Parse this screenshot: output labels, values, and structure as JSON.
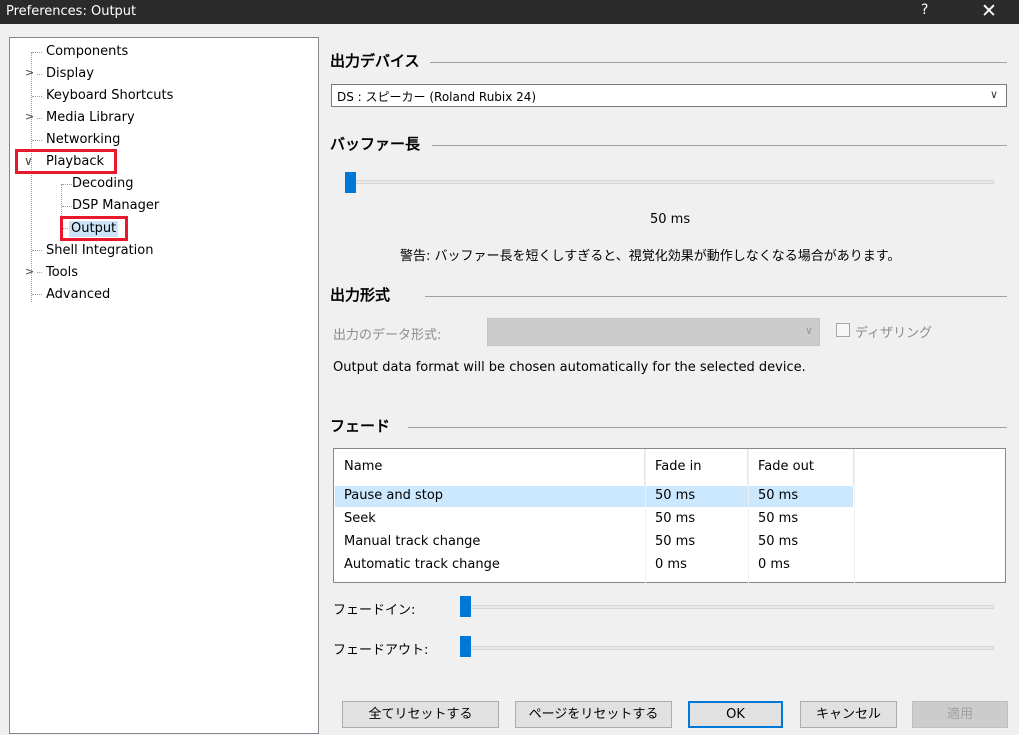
{
  "window": {
    "title": "Preferences: Output",
    "help_label": "?",
    "close_label": "✕"
  },
  "tree": {
    "items": [
      {
        "label": "Components"
      },
      {
        "label": "Display"
      },
      {
        "label": "Keyboard Shortcuts"
      },
      {
        "label": "Media Library"
      },
      {
        "label": "Networking"
      },
      {
        "label": "Playback"
      },
      {
        "label": "Decoding"
      },
      {
        "label": "DSP Manager"
      },
      {
        "label": "Output"
      },
      {
        "label": "Shell Integration"
      },
      {
        "label": "Tools"
      },
      {
        "label": "Advanced"
      }
    ],
    "selected": "Output"
  },
  "output_device": {
    "heading": "出力デバイス",
    "selected": "DS : スピーカー (Roland Rubix 24)"
  },
  "buffer": {
    "heading": "バッファー長",
    "value_label": "50 ms",
    "slider_fraction": 0.0,
    "warning": "警告: バッファー長を短くしすぎると、視覚化効果が動作しなくなる場合があります。"
  },
  "output_format": {
    "heading": "出力形式",
    "data_format_label": "出力のデータ形式:",
    "data_format_value": "",
    "dither_label": "ディザリング",
    "dither_checked": false,
    "auto_note": "Output data format will be chosen automatically for the selected device."
  },
  "fade": {
    "heading": "フェード",
    "columns": [
      "Name",
      "Fade in",
      "Fade out"
    ],
    "rows": [
      {
        "name": "Pause and stop",
        "fade_in": "50 ms",
        "fade_out": "50 ms",
        "selected": true
      },
      {
        "name": "Seek",
        "fade_in": "50 ms",
        "fade_out": "50 ms",
        "selected": false
      },
      {
        "name": "Manual track change",
        "fade_in": "50 ms",
        "fade_out": "50 ms",
        "selected": false
      },
      {
        "name": "Automatic track change",
        "fade_in": "0 ms",
        "fade_out": "0 ms",
        "selected": false
      }
    ],
    "fade_in_label": "フェードイン:",
    "fade_in_fraction": 0.0,
    "fade_out_label": "フェードアウト:",
    "fade_out_fraction": 0.0
  },
  "buttons": {
    "reset_all": "全てリセットする",
    "reset_page": "ページをリセットする",
    "ok": "OK",
    "cancel": "キャンセル",
    "apply": "適用"
  },
  "colors": {
    "accent": "#0078d7",
    "highlight_box": "#e8192c",
    "selection": "#cce8ff"
  }
}
